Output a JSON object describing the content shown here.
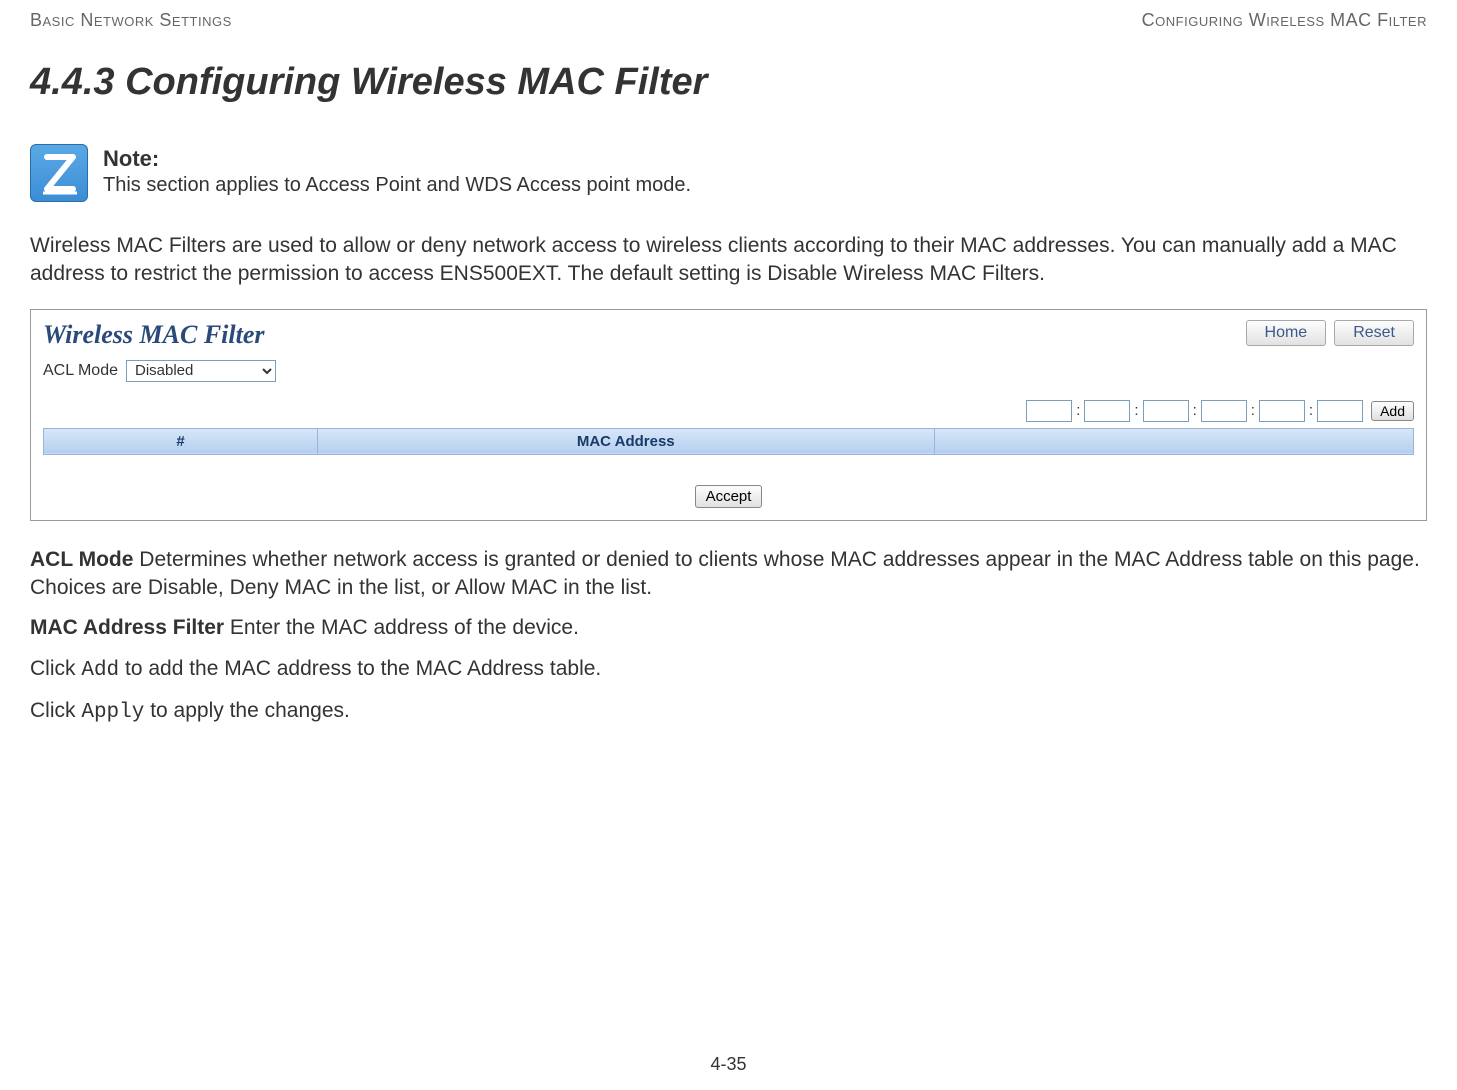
{
  "header": {
    "left": "Basic Network Settings",
    "right": "Configuring Wireless MAC Filter"
  },
  "section_heading": "4.4.3 Configuring Wireless MAC Filter",
  "note": {
    "title": "Note:",
    "body": "This section applies to Access Point and WDS Access point mode."
  },
  "intro": "Wireless MAC Filters are used to allow or deny network access to wireless clients according to their MAC addresses. You can manually add a MAC address to restrict the permission to access ENS500EXT. The default setting is Disable Wireless MAC Filters.",
  "ui": {
    "title": "Wireless MAC Filter",
    "home_btn": "Home",
    "reset_btn": "Reset",
    "acl_label": "ACL Mode",
    "acl_value": "Disabled",
    "add_btn": "Add",
    "colon": ":",
    "table_headers": {
      "index": "#",
      "mac": "MAC Address",
      "action": ""
    },
    "accept_btn": "Accept"
  },
  "descriptions": {
    "acl_label": "ACL Mode",
    "acl_text": "  Determines whether network access is granted or denied to clients whose MAC addresses appear in the MAC Address table on this page. Choices are Disable, Deny MAC in the list, or Allow MAC in the list.",
    "mac_label": "MAC Address Filter",
    "mac_text": "  Enter the MAC address of the device.",
    "add_pre": "Click ",
    "add_mono": "Add",
    "add_post": " to add the MAC address to the MAC Address table.",
    "apply_pre": "Click ",
    "apply_mono": "Apply",
    "apply_post": " to apply the changes."
  },
  "page_number": "4-35"
}
